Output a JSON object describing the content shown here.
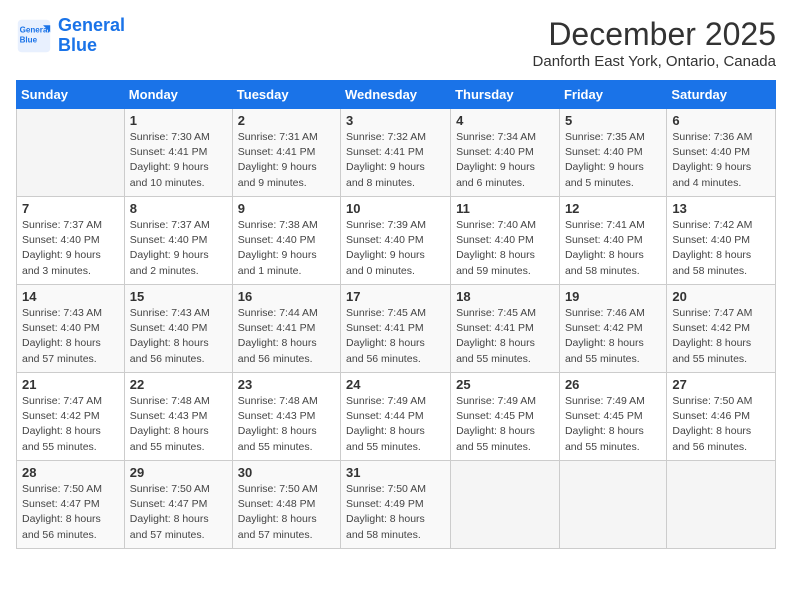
{
  "header": {
    "logo_line1": "General",
    "logo_line2": "Blue",
    "month": "December 2025",
    "location": "Danforth East York, Ontario, Canada"
  },
  "weekdays": [
    "Sunday",
    "Monday",
    "Tuesday",
    "Wednesday",
    "Thursday",
    "Friday",
    "Saturday"
  ],
  "weeks": [
    [
      {
        "day": "",
        "info": ""
      },
      {
        "day": "1",
        "info": "Sunrise: 7:30 AM\nSunset: 4:41 PM\nDaylight: 9 hours\nand 10 minutes."
      },
      {
        "day": "2",
        "info": "Sunrise: 7:31 AM\nSunset: 4:41 PM\nDaylight: 9 hours\nand 9 minutes."
      },
      {
        "day": "3",
        "info": "Sunrise: 7:32 AM\nSunset: 4:41 PM\nDaylight: 9 hours\nand 8 minutes."
      },
      {
        "day": "4",
        "info": "Sunrise: 7:34 AM\nSunset: 4:40 PM\nDaylight: 9 hours\nand 6 minutes."
      },
      {
        "day": "5",
        "info": "Sunrise: 7:35 AM\nSunset: 4:40 PM\nDaylight: 9 hours\nand 5 minutes."
      },
      {
        "day": "6",
        "info": "Sunrise: 7:36 AM\nSunset: 4:40 PM\nDaylight: 9 hours\nand 4 minutes."
      }
    ],
    [
      {
        "day": "7",
        "info": "Sunrise: 7:37 AM\nSunset: 4:40 PM\nDaylight: 9 hours\nand 3 minutes."
      },
      {
        "day": "8",
        "info": "Sunrise: 7:37 AM\nSunset: 4:40 PM\nDaylight: 9 hours\nand 2 minutes."
      },
      {
        "day": "9",
        "info": "Sunrise: 7:38 AM\nSunset: 4:40 PM\nDaylight: 9 hours\nand 1 minute."
      },
      {
        "day": "10",
        "info": "Sunrise: 7:39 AM\nSunset: 4:40 PM\nDaylight: 9 hours\nand 0 minutes."
      },
      {
        "day": "11",
        "info": "Sunrise: 7:40 AM\nSunset: 4:40 PM\nDaylight: 8 hours\nand 59 minutes."
      },
      {
        "day": "12",
        "info": "Sunrise: 7:41 AM\nSunset: 4:40 PM\nDaylight: 8 hours\nand 58 minutes."
      },
      {
        "day": "13",
        "info": "Sunrise: 7:42 AM\nSunset: 4:40 PM\nDaylight: 8 hours\nand 58 minutes."
      }
    ],
    [
      {
        "day": "14",
        "info": "Sunrise: 7:43 AM\nSunset: 4:40 PM\nDaylight: 8 hours\nand 57 minutes."
      },
      {
        "day": "15",
        "info": "Sunrise: 7:43 AM\nSunset: 4:40 PM\nDaylight: 8 hours\nand 56 minutes."
      },
      {
        "day": "16",
        "info": "Sunrise: 7:44 AM\nSunset: 4:41 PM\nDaylight: 8 hours\nand 56 minutes."
      },
      {
        "day": "17",
        "info": "Sunrise: 7:45 AM\nSunset: 4:41 PM\nDaylight: 8 hours\nand 56 minutes."
      },
      {
        "day": "18",
        "info": "Sunrise: 7:45 AM\nSunset: 4:41 PM\nDaylight: 8 hours\nand 55 minutes."
      },
      {
        "day": "19",
        "info": "Sunrise: 7:46 AM\nSunset: 4:42 PM\nDaylight: 8 hours\nand 55 minutes."
      },
      {
        "day": "20",
        "info": "Sunrise: 7:47 AM\nSunset: 4:42 PM\nDaylight: 8 hours\nand 55 minutes."
      }
    ],
    [
      {
        "day": "21",
        "info": "Sunrise: 7:47 AM\nSunset: 4:42 PM\nDaylight: 8 hours\nand 55 minutes."
      },
      {
        "day": "22",
        "info": "Sunrise: 7:48 AM\nSunset: 4:43 PM\nDaylight: 8 hours\nand 55 minutes."
      },
      {
        "day": "23",
        "info": "Sunrise: 7:48 AM\nSunset: 4:43 PM\nDaylight: 8 hours\nand 55 minutes."
      },
      {
        "day": "24",
        "info": "Sunrise: 7:49 AM\nSunset: 4:44 PM\nDaylight: 8 hours\nand 55 minutes."
      },
      {
        "day": "25",
        "info": "Sunrise: 7:49 AM\nSunset: 4:45 PM\nDaylight: 8 hours\nand 55 minutes."
      },
      {
        "day": "26",
        "info": "Sunrise: 7:49 AM\nSunset: 4:45 PM\nDaylight: 8 hours\nand 55 minutes."
      },
      {
        "day": "27",
        "info": "Sunrise: 7:50 AM\nSunset: 4:46 PM\nDaylight: 8 hours\nand 56 minutes."
      }
    ],
    [
      {
        "day": "28",
        "info": "Sunrise: 7:50 AM\nSunset: 4:47 PM\nDaylight: 8 hours\nand 56 minutes."
      },
      {
        "day": "29",
        "info": "Sunrise: 7:50 AM\nSunset: 4:47 PM\nDaylight: 8 hours\nand 57 minutes."
      },
      {
        "day": "30",
        "info": "Sunrise: 7:50 AM\nSunset: 4:48 PM\nDaylight: 8 hours\nand 57 minutes."
      },
      {
        "day": "31",
        "info": "Sunrise: 7:50 AM\nSunset: 4:49 PM\nDaylight: 8 hours\nand 58 minutes."
      },
      {
        "day": "",
        "info": ""
      },
      {
        "day": "",
        "info": ""
      },
      {
        "day": "",
        "info": ""
      }
    ]
  ]
}
